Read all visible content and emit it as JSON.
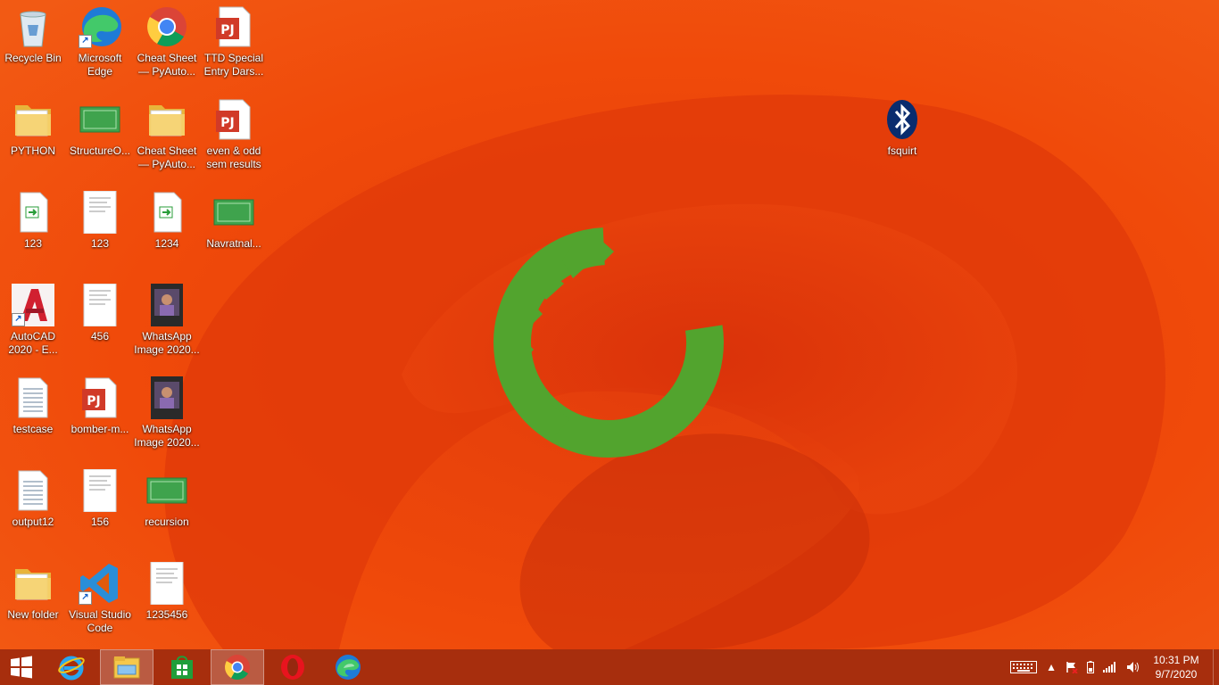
{
  "desktop": {
    "icons": [
      {
        "label": "Recycle Bin",
        "icon": "recycle-bin-icon"
      },
      {
        "label": "Microsoft Edge",
        "icon": "edge-icon"
      },
      {
        "label": "Cheat Sheet — PyAuto...",
        "icon": "chrome-icon"
      },
      {
        "label": "TTD Special Entry Dars...",
        "icon": "pdf-icon"
      },
      {
        "label": "PYTHON",
        "icon": "folder-icon"
      },
      {
        "label": "StructureO...",
        "icon": "image-icon"
      },
      {
        "label": "Cheat Sheet — PyAuto...",
        "icon": "folder-icon"
      },
      {
        "label": "even & odd sem results",
        "icon": "pdf-icon"
      },
      {
        "label": "123",
        "icon": "file-icon"
      },
      {
        "label": "123",
        "icon": "document-thumb-icon"
      },
      {
        "label": "1234",
        "icon": "file-icon"
      },
      {
        "label": "Navratnal...",
        "icon": "image-icon"
      },
      {
        "label": "AutoCAD 2020 - E...",
        "icon": "autocad-icon"
      },
      {
        "label": "456",
        "icon": "document-thumb-icon"
      },
      {
        "label": "WhatsApp Image 2020...",
        "icon": "photo-icon"
      },
      {
        "label": "testcase",
        "icon": "text-file-icon"
      },
      {
        "label": "bomber-m...",
        "icon": "pdf-icon"
      },
      {
        "label": "WhatsApp Image 2020...",
        "icon": "photo-icon"
      },
      {
        "label": "output12",
        "icon": "text-file-icon"
      },
      {
        "label": "156",
        "icon": "document-thumb-icon"
      },
      {
        "label": "recursion",
        "icon": "image-icon"
      },
      {
        "label": "New folder",
        "icon": "folder-icon"
      },
      {
        "label": "Visual Studio Code",
        "icon": "vscode-icon"
      },
      {
        "label": "1235456",
        "icon": "document-thumb-icon"
      },
      {
        "label": "fsquirt",
        "icon": "bluetooth-icon"
      }
    ]
  },
  "taskbar": {
    "apps": [
      {
        "name": "start",
        "icon": "windows-start-icon"
      },
      {
        "name": "internet-explorer",
        "icon": "internet-explorer-icon"
      },
      {
        "name": "file-explorer",
        "icon": "file-explorer-icon",
        "active": true
      },
      {
        "name": "store",
        "icon": "store-icon"
      },
      {
        "name": "chrome",
        "icon": "chrome-icon",
        "active": true
      },
      {
        "name": "opera",
        "icon": "opera-icon"
      },
      {
        "name": "edge",
        "icon": "edge-icon"
      }
    ],
    "tray": {
      "icons": [
        "keyboard-icon",
        "chevron-up-icon",
        "action-center-flag-icon",
        "battery-icon",
        "signal-icon",
        "volume-icon"
      ],
      "time": "10:31 PM",
      "date": "9/7/2020"
    }
  },
  "colors": {
    "wallpaper_primary": "#f04a0a",
    "wallpaper_dark": "#c8280a",
    "logo_green": "#52a42e",
    "taskbar": "#96280f"
  }
}
